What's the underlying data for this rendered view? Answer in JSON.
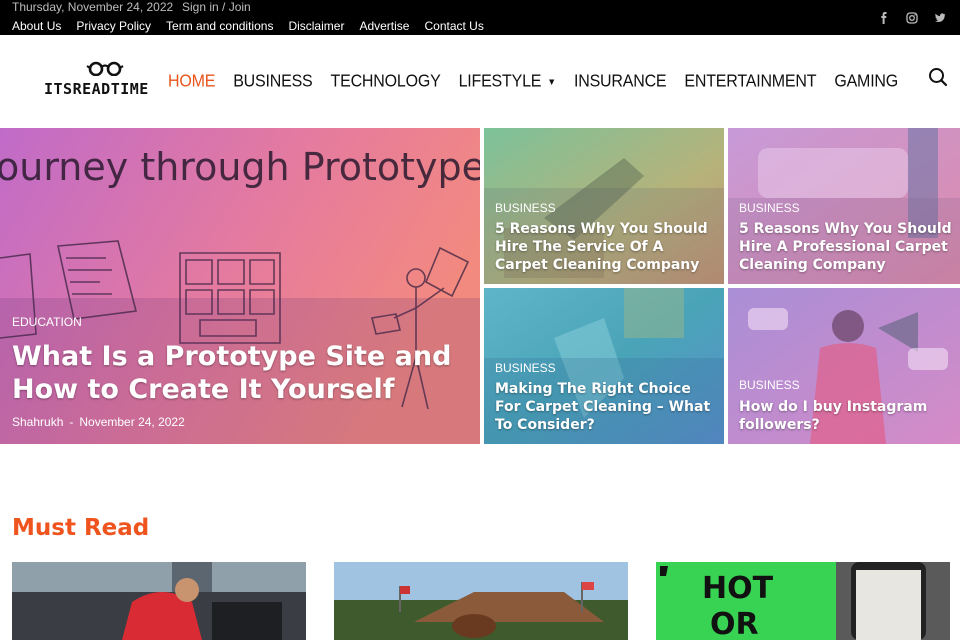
{
  "topbar": {
    "date": "Thursday, November 24, 2022",
    "signin": "Sign in / Join",
    "links": [
      "About Us",
      "Privacy Policy",
      "Term and conditions",
      "Disclaimer",
      "Advertise",
      "Contact Us"
    ],
    "social_icons": [
      "facebook-icon",
      "instagram-icon",
      "twitter-icon"
    ]
  },
  "header": {
    "logo_text": "ITSREADTIME",
    "nav": [
      {
        "label": "Home",
        "active": true
      },
      {
        "label": "Business"
      },
      {
        "label": "Technology"
      },
      {
        "label": "Lifestyle",
        "has_dropdown": true
      },
      {
        "label": "Insurance"
      },
      {
        "label": "Entertainment"
      },
      {
        "label": "Gaming"
      }
    ],
    "search_icon": "search-icon",
    "accent": "#e7541c"
  },
  "hero": {
    "featured": {
      "category": "EDUCATION",
      "title": "What Is a Prototype Site and How to Create It Yourself",
      "author": "Shahrukh",
      "date": "November 24, 2022",
      "image_text": "ourney through Prototypes"
    },
    "tiles": [
      {
        "category": "BUSINESS",
        "title": "5 Reasons Why You Should Hire The Service Of A Carpet Cleaning Company"
      },
      {
        "category": "BUSINESS",
        "title": "5 Reasons Why You Should Hire A Professional Carpet Cleaning Company"
      },
      {
        "category": "BUSINESS",
        "title": "Making The Right Choice For Carpet Cleaning – What To Consider?"
      },
      {
        "category": "BUSINESS",
        "title": "How do I buy Instagram followers?"
      }
    ]
  },
  "must_read": {
    "heading": "Must Read",
    "card3_text_1": "HOT",
    "card3_text_2": "OR"
  }
}
